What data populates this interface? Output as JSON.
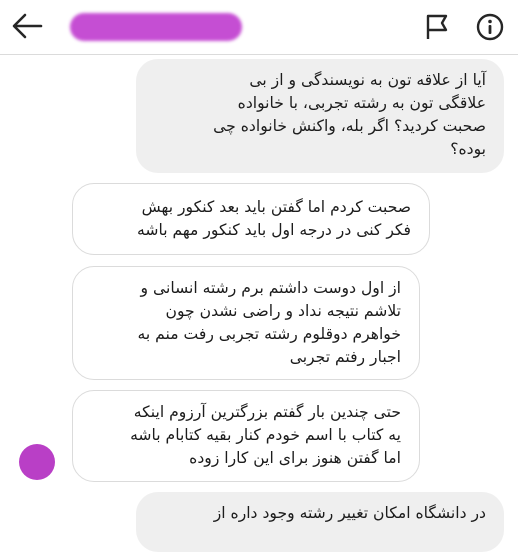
{
  "header": {
    "back_icon": "arrow-left-icon",
    "flag_icon": "flag-icon",
    "info_icon": "info-icon"
  },
  "messages": [
    {
      "side": "out",
      "lines": [
        "آیا از علاقه تون به نویسندگی و از بی",
        "علاقگی تون به رشته تجربی، با خانواده",
        "صحبت کردید؟ اگر بله، واکنش خانواده چی",
        "بوده؟"
      ]
    },
    {
      "side": "in",
      "lines": [
        "صحبت کردم اما گفتن باید بعد کنکور بهش",
        "فکر کنی در درجه اول باید کنکور مهم باشه"
      ]
    },
    {
      "side": "in",
      "lines": [
        "از اول دوست داشتم برم رشته انسانی و",
        "تلاشم نتیجه نداد و راضی نشدن چون",
        "خواهرم دوقلوم رشته تجربی رفت منم به",
        "اجبار رفتم تجربی"
      ]
    },
    {
      "side": "in",
      "lines": [
        "حتی چندین بار گفتم بزرگترین آرزوم اینکه",
        "یه کتاب با اسم خودم کنار بقیه کتابام باشه",
        "اما گفتن هنوز برای این کارا زوده"
      ]
    },
    {
      "side": "out",
      "lines": [
        "در دانشگاه امکان تغییر رشته وجود داره از"
      ]
    }
  ]
}
